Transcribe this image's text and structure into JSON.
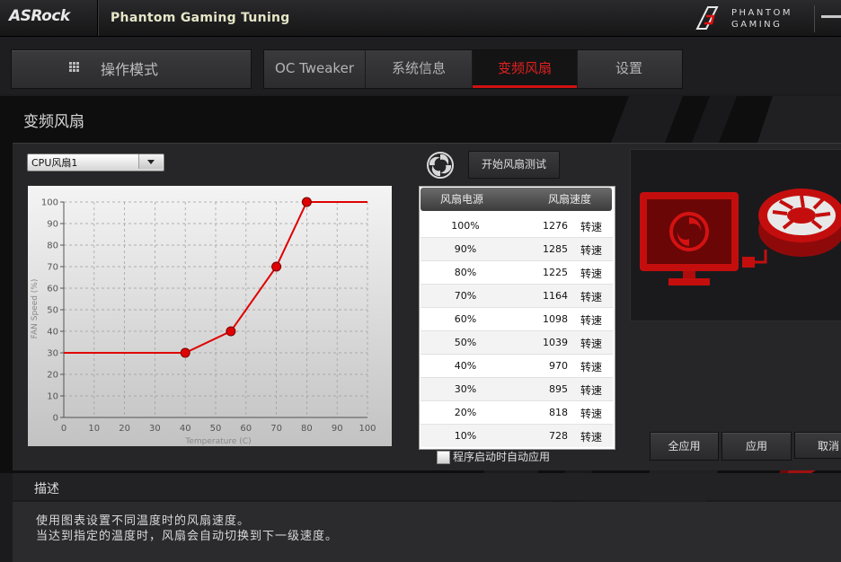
{
  "app": {
    "brand": "ASRock",
    "title": "Phantom Gaming Tuning",
    "pg_line1": "PHANTOM",
    "pg_line2": "GAMING"
  },
  "toolbar": {
    "mode_label": "操作模式",
    "tabs": [
      {
        "label": "OC Tweaker",
        "active": false
      },
      {
        "label": "系统信息",
        "active": false
      },
      {
        "label": "变频风扇",
        "active": true
      },
      {
        "label": "设置",
        "active": false
      }
    ]
  },
  "page": {
    "title": "变频风扇"
  },
  "fan_select": {
    "value": "CPU风扇1"
  },
  "fan_test_button": "开始风扇测试",
  "table": {
    "headers": [
      "风扇电源",
      "风扇速度"
    ],
    "rows": [
      {
        "power": "100%",
        "rpm": "1276",
        "unit": "转速"
      },
      {
        "power": "90%",
        "rpm": "1285",
        "unit": "转速"
      },
      {
        "power": "80%",
        "rpm": "1225",
        "unit": "转速"
      },
      {
        "power": "70%",
        "rpm": "1164",
        "unit": "转速"
      },
      {
        "power": "60%",
        "rpm": "1098",
        "unit": "转速"
      },
      {
        "power": "50%",
        "rpm": "1039",
        "unit": "转速"
      },
      {
        "power": "40%",
        "rpm": "970",
        "unit": "转速"
      },
      {
        "power": "30%",
        "rpm": "895",
        "unit": "转速"
      },
      {
        "power": "20%",
        "rpm": "818",
        "unit": "转速"
      },
      {
        "power": "10%",
        "rpm": "728",
        "unit": "转速"
      }
    ]
  },
  "auto_apply_label": "程序启动时自动应用",
  "buttons": {
    "apply_all": "全应用",
    "apply": "应用",
    "cancel": "取消"
  },
  "description": {
    "title": "描述",
    "line1": "使用图表设置不同温度时的风扇速度。",
    "line2": "当达到指定的温度时，风扇会自动切换到下一级速度。"
  },
  "colors": {
    "accent": "#e01010",
    "curve": "#e00000"
  },
  "chart_data": {
    "type": "line",
    "xlabel": "Temperature (C)",
    "ylabel": "FAN Speed (%)",
    "xlim": [
      0,
      100
    ],
    "ylim": [
      0,
      100
    ],
    "xticks": [
      0,
      10,
      20,
      30,
      40,
      50,
      60,
      70,
      80,
      90,
      100
    ],
    "yticks": [
      0,
      10,
      20,
      30,
      40,
      50,
      60,
      70,
      80,
      90,
      100
    ],
    "grid": true,
    "series": [
      {
        "x": [
          0,
          40,
          55,
          70,
          80,
          100
        ],
        "y": [
          30,
          30,
          40,
          70,
          100,
          100
        ]
      }
    ],
    "control_points": [
      {
        "x": 40,
        "y": 30
      },
      {
        "x": 55,
        "y": 40
      },
      {
        "x": 70,
        "y": 70
      },
      {
        "x": 80,
        "y": 100
      }
    ]
  }
}
